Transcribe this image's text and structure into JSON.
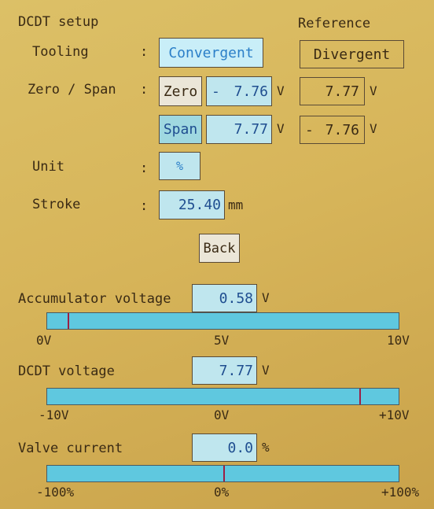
{
  "header": {
    "title": "DCDT setup",
    "reference_label": "Reference"
  },
  "tooling": {
    "label": "Tooling",
    "colon": ":",
    "selected": "Convergent",
    "reference": "Divergent"
  },
  "zero_span": {
    "label": "Zero / Span",
    "colon": ":",
    "zero_button": "Zero",
    "span_button": "Span",
    "zero_sign": "-",
    "zero_value": "7.76",
    "span_value": "7.77",
    "ref_zero_value": "7.77",
    "ref_span_sign": "-",
    "ref_span_value": "7.76",
    "unit": "V"
  },
  "unit_row": {
    "label": "Unit",
    "colon": ":",
    "value": "%"
  },
  "stroke": {
    "label": "Stroke",
    "colon": ":",
    "value": "25.40",
    "unit": "mm"
  },
  "back_button": "Back",
  "accumulator": {
    "label": "Accumulator voltage",
    "value": "0.58",
    "unit": "V",
    "scale": [
      "0V",
      "5V",
      "10V"
    ],
    "range": [
      0,
      10
    ],
    "level": 0.58
  },
  "dcdt": {
    "label": "DCDT voltage",
    "value": "7.77",
    "unit": "V",
    "scale": [
      "-10V",
      "0V",
      "+10V"
    ],
    "range": [
      -10,
      10
    ],
    "level": 7.77
  },
  "valve": {
    "label": "Valve current",
    "value": "0.0",
    "unit": "%",
    "scale": [
      "-100%",
      "0%",
      "+100%"
    ],
    "range": [
      -100,
      100
    ],
    "level": 0.0
  },
  "colors": {
    "background": "#d7b55a",
    "field": "#bfe6ee",
    "bar": "#5fc8df",
    "marker": "#9b1f45",
    "value_text": "#1f4e90"
  }
}
